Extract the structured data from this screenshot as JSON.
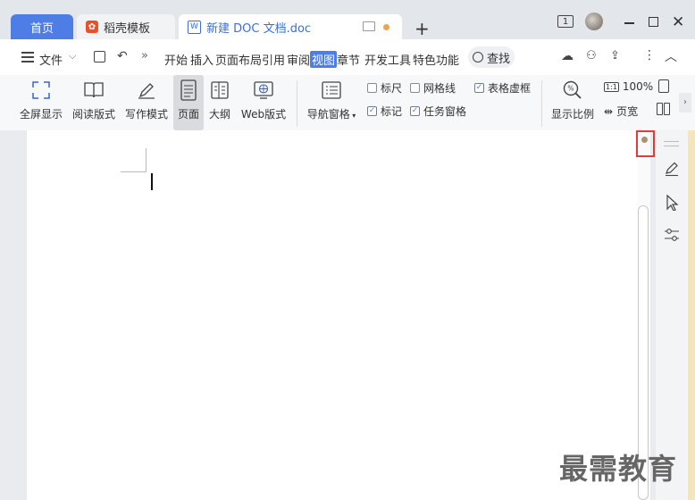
{
  "tabs": [
    {
      "label": "首页"
    },
    {
      "label": "稻壳模板"
    },
    {
      "label": "新建 DOC 文档.doc"
    }
  ],
  "window": {
    "page_indicator": "1"
  },
  "menu": {
    "file_label": "文件",
    "items": [
      "开始",
      "插入",
      "页面布局",
      "引用",
      "审阅",
      "视图",
      "章节",
      "开发工具",
      "特色功能"
    ],
    "active": "视图",
    "search_label": "查找"
  },
  "ribbon": {
    "buttons": [
      {
        "label": "全屏显示",
        "icon": "fullscreen-icon"
      },
      {
        "label": "阅读版式",
        "icon": "book-icon"
      },
      {
        "label": "写作模式",
        "icon": "pen-icon"
      },
      {
        "label": "页面",
        "icon": "page-icon"
      },
      {
        "label": "大纲",
        "icon": "outline-icon"
      },
      {
        "label": "Web版式",
        "icon": "web-icon"
      },
      {
        "label": "导航窗格",
        "icon": "nav-pane-icon"
      }
    ],
    "checkboxes": [
      {
        "label": "标尺",
        "checked": false
      },
      {
        "label": "网格线",
        "checked": false
      },
      {
        "label": "表格虚框",
        "checked": true
      },
      {
        "label": "标记",
        "checked": true
      },
      {
        "label": "任务窗格",
        "checked": true
      }
    ],
    "zoom_button_label": "显示比例",
    "zoom_value": "100%",
    "zoom_chip": "1:1",
    "page_width_label": "页宽"
  },
  "watermark": "最需教育",
  "colors": {
    "accent": "#4f7de6",
    "highlight_box": "#e03c3c"
  }
}
